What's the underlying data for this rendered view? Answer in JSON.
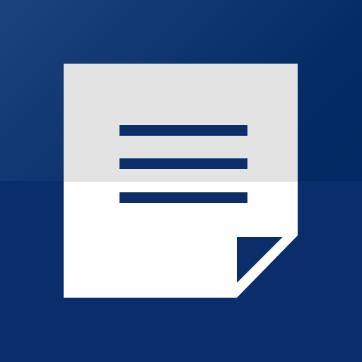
{
  "icon": {
    "name": "document-note-icon",
    "colors": {
      "background_dark": "#002761",
      "background_light": "#1a3f7a",
      "background_bottom": "#0a2e6c",
      "page_top": "#e3e3e3",
      "page_bottom": "#ffffff",
      "text_lines": "#0b2d68",
      "fold": "#0b2d68"
    },
    "text_line_count": 3
  }
}
